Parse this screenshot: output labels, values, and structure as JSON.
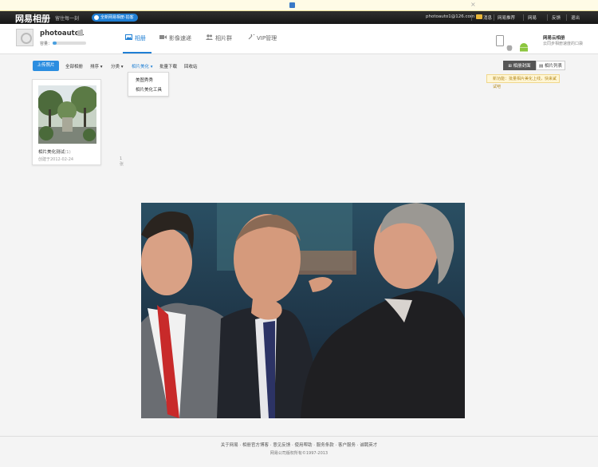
{
  "topbar": {
    "logo": "网易相册",
    "slogan": "留住每一刻",
    "app_button": "全新网易相册·拍客",
    "links": {
      "account": "photoauto1@126.com",
      "messages": "消息",
      "recommend": "网易推荐",
      "netease": "网易",
      "feedback": "反馈",
      "logout": "退出"
    }
  },
  "header": {
    "username": "photoauto1",
    "space_label": "容量：",
    "space_used_fraction": 0.12,
    "tabs": [
      {
        "label": "相册",
        "icon": "image-icon"
      },
      {
        "label": "影像速递",
        "icon": "video-icon"
      },
      {
        "label": "相片群",
        "icon": "group-icon"
      },
      {
        "label": "VIP管理",
        "icon": "wrench-icon"
      }
    ],
    "promo_title": "网易云相册",
    "promo_subtitle": "云同步相册速度的口袋"
  },
  "toolbar": {
    "upload": "上传照片",
    "items": [
      "全部相册",
      "排序",
      "分类",
      "相片美化",
      "批量下载",
      "回收站"
    ],
    "dropdown": [
      "美图秀秀",
      "相片美化工具"
    ],
    "view_grid": "相册封面",
    "view_list": "相片列表",
    "tip": "新功能：批量相片美化上线，快来试试吧"
  },
  "album": {
    "name": "相片美化测试",
    "count_in_name": "(1)",
    "date": "创建于2012-02-24",
    "count": "1张"
  },
  "footer": {
    "links": "关于网易 · 相册官方博客 · 意见反馈 · 使用帮助 · 服务条款 · 客户服务 · 诚聘英才",
    "copyright": "网易公司版权所有©1997-2013"
  },
  "colors": {
    "accent": "#1f7fd4",
    "topbar": "#1d1d1d"
  }
}
